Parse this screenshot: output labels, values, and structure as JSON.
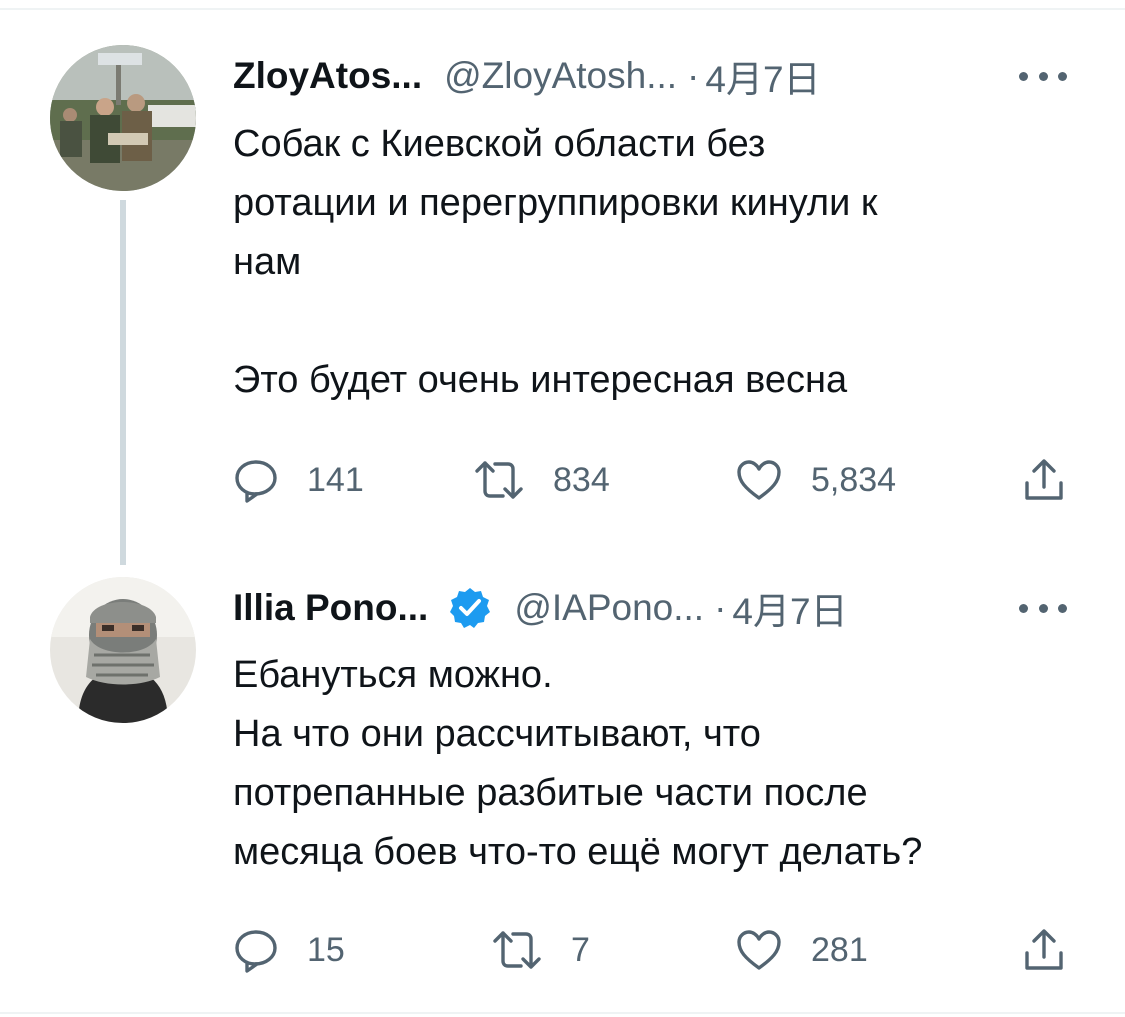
{
  "tweets": [
    {
      "name": "ZloyAtos...",
      "handle": "@ZloyAtosh...",
      "separator": "·",
      "date": "4月7日",
      "verified": false,
      "text": [
        "Собак с Киевской области без",
        "ротации и перегруппировки кинули к",
        "нам",
        "",
        "Это будет очень интересная весна"
      ],
      "replies": "141",
      "retweets": "834",
      "likes": "5,834"
    },
    {
      "name": "Illia Pono...",
      "handle": "@IAPono...",
      "separator": "·",
      "date": "4月7日",
      "verified": true,
      "text": [
        "Ебануться можно.",
        "На что они рассчитывают, что",
        "потрепанные разбитые части после",
        "месяца боев что-то ещё могут делать?"
      ],
      "replies": "15",
      "retweets": "7",
      "likes": "281"
    }
  ],
  "icons": [
    "reply-icon",
    "retweet-icon",
    "like-icon",
    "share-icon",
    "more-icon",
    "verified-badge-icon"
  ],
  "colors": {
    "secondary_text": "#536471",
    "verified_blue": "#1d9bf0",
    "thread_line": "#cfd9de"
  }
}
